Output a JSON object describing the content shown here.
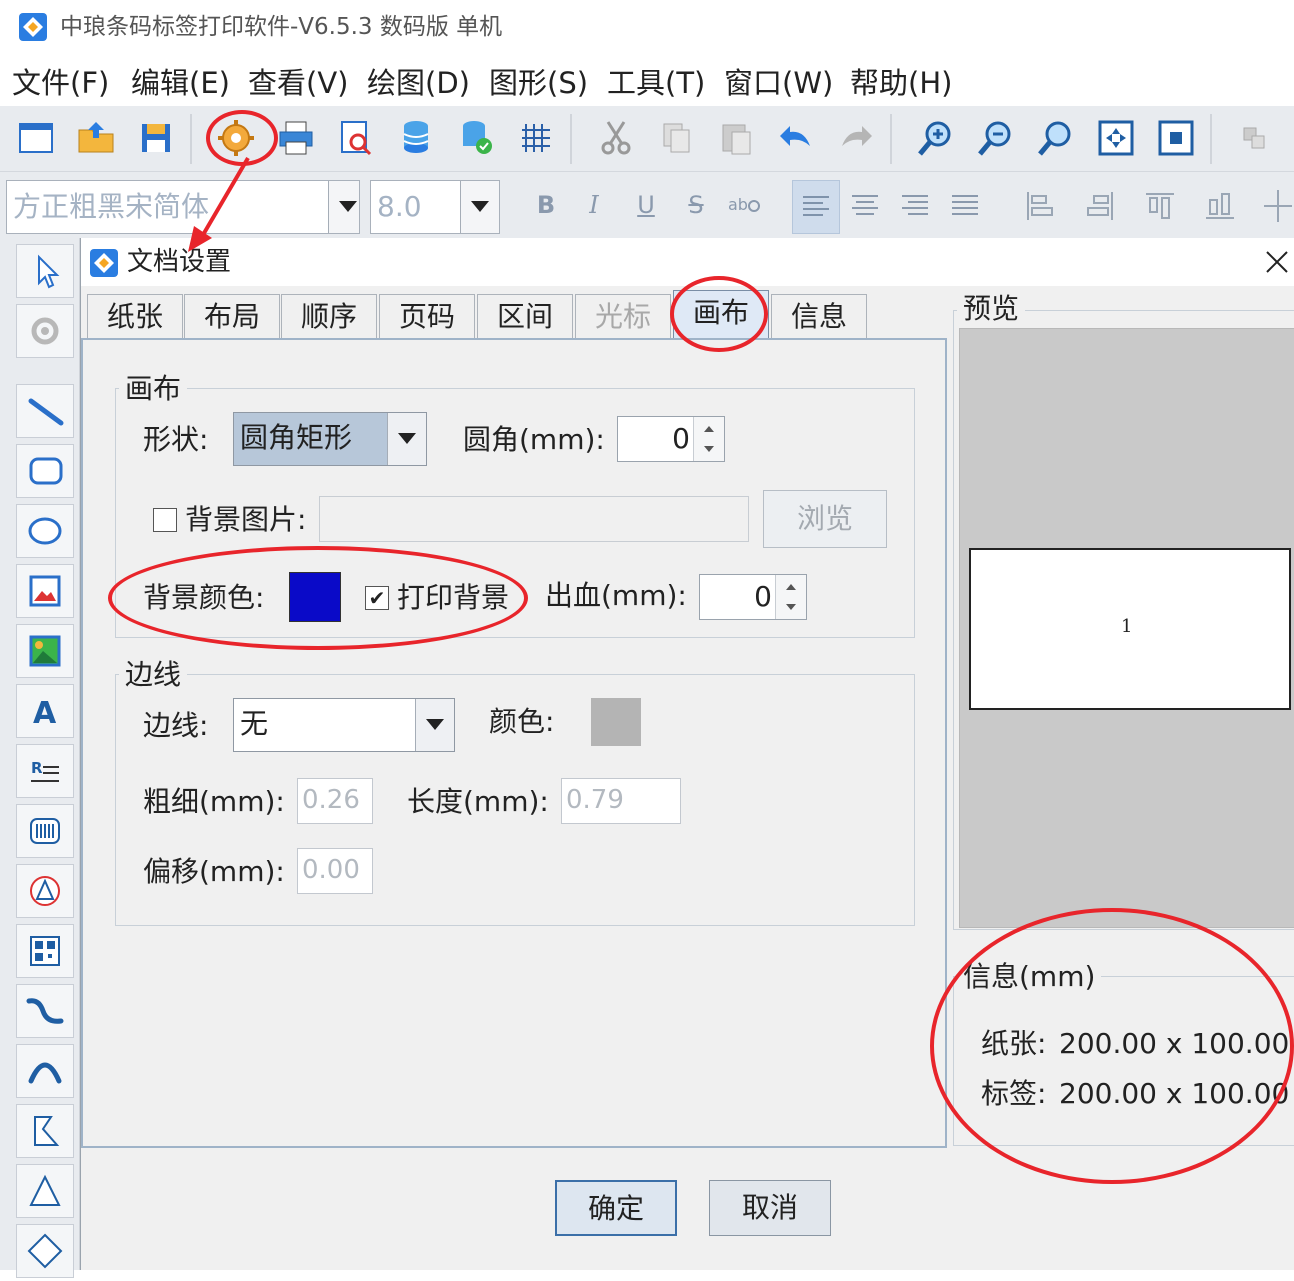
{
  "app": {
    "title": "中琅条码标签打印软件-V6.5.3 数码版 单机"
  },
  "menu": [
    "文件(F)",
    "编辑(E)",
    "查看(V)",
    "绘图(D)",
    "图形(S)",
    "工具(T)",
    "窗口(W)",
    "帮助(H)"
  ],
  "format_toolbar": {
    "font_name": "方正粗黑宋简体",
    "font_size": "8.0",
    "bold": "B",
    "italic": "I",
    "underline": "U",
    "strike": "S"
  },
  "dialog": {
    "title": "文档设置",
    "tabs": [
      "纸张",
      "布局",
      "顺序",
      "页码",
      "区间",
      "光标",
      "画布",
      "信息"
    ],
    "active_tab": "画布",
    "canvas_group": {
      "legend": "画布",
      "shape_label": "形状:",
      "shape_value": "圆角矩形",
      "radius_label": "圆角(mm):",
      "radius_value": "0",
      "bg_image_label": "背景图片:",
      "browse_label": "浏览",
      "bg_color_label": "背景颜色:",
      "bg_color": "#0a0ac8",
      "print_bg_label": "打印背景",
      "print_bg_checked": "✔",
      "bleed_label": "出血(mm):",
      "bleed_value": "0"
    },
    "border_group": {
      "legend": "边线",
      "border_label": "边线:",
      "border_value": "无",
      "color_label": "颜色:",
      "border_color": "#b4b4b4",
      "thickness_label": "粗细(mm):",
      "thickness_value": "0.26",
      "length_label": "长度(mm):",
      "length_value": "0.79",
      "offset_label": "偏移(mm):",
      "offset_value": "0.00"
    },
    "preview": {
      "legend": "预览",
      "page_number": "1"
    },
    "info": {
      "legend": "信息(mm)",
      "paper_label": "纸张:",
      "paper_value": "200.00 x 100.00",
      "label_label": "标签:",
      "label_value": "200.00 x 100.00"
    },
    "ok_label": "确定",
    "cancel_label": "取消"
  }
}
